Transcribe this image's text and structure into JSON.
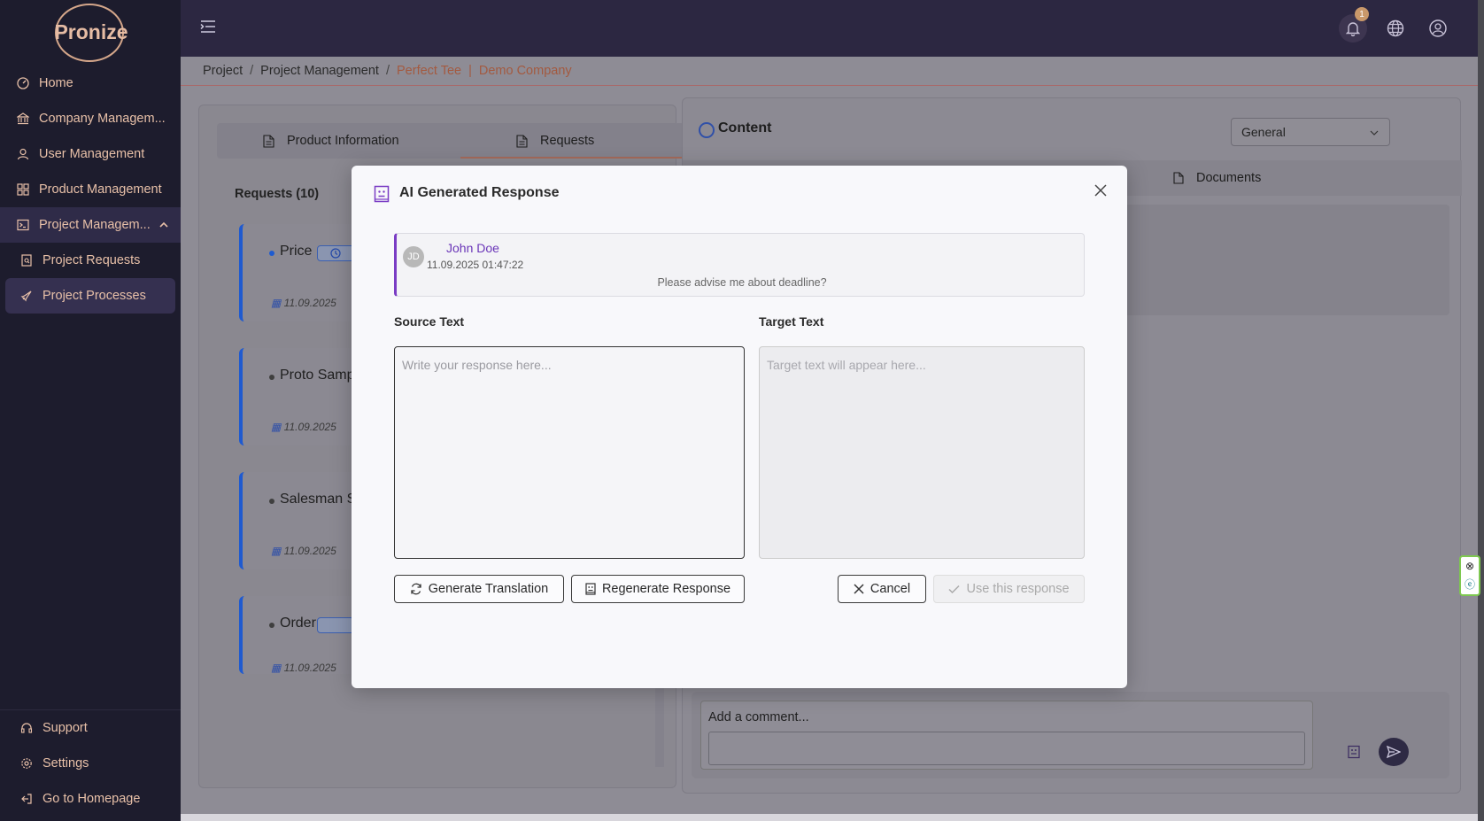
{
  "app": {
    "logo": "Pronize"
  },
  "sidebar": {
    "items": [
      {
        "label": "Home",
        "icon": "dashboard-icon"
      },
      {
        "label": "Company Managem...",
        "icon": "bank-icon"
      },
      {
        "label": "User Management",
        "icon": "user-icon"
      },
      {
        "label": "Product Management",
        "icon": "grid-icon"
      },
      {
        "label": "Project Managem...",
        "icon": "terminal-icon"
      },
      {
        "label": "Project Requests",
        "icon": "file-search-icon"
      },
      {
        "label": "Project Processes",
        "icon": "rocket-icon"
      }
    ],
    "bottom": [
      {
        "label": "Support",
        "icon": "headset-icon"
      },
      {
        "label": "Settings",
        "icon": "gear-icon"
      },
      {
        "label": "Go to Homepage",
        "icon": "exit-icon"
      }
    ]
  },
  "topbar": {
    "notification_count": "1"
  },
  "breadcrumb": {
    "project": "Project",
    "management": "Project Management",
    "product": "Perfect Tee",
    "sep2": "|",
    "company": "Demo Company"
  },
  "left_panel": {
    "tabs": [
      "Product Information",
      "Requests"
    ],
    "requests_title": "Requests (10)",
    "requests": [
      {
        "name": "Price",
        "date": "11.09.2025"
      },
      {
        "name": "Proto Samp",
        "date": "11.09.2025"
      },
      {
        "name": "Salesman S",
        "date": "11.09.2025"
      },
      {
        "name": "Order",
        "date": "11.09.2025"
      }
    ]
  },
  "right_panel": {
    "title": "Content",
    "select_value": "General",
    "documents_tab": "Documents",
    "comment_placeholder": "Add a comment..."
  },
  "modal": {
    "title": "AI Generated Response",
    "message": {
      "initials": "JD",
      "author": "John Doe",
      "timestamp": "11.09.2025 01:47:22",
      "text": "Please advise me about deadline?"
    },
    "source_label": "Source Text",
    "target_label": "Target Text",
    "source_placeholder": "Write your response here...",
    "target_placeholder": "Target text will appear here...",
    "buttons": {
      "generate_translation": "Generate Translation",
      "regenerate_response": "Regenerate Response",
      "cancel": "Cancel",
      "use_response": "Use this response"
    }
  }
}
